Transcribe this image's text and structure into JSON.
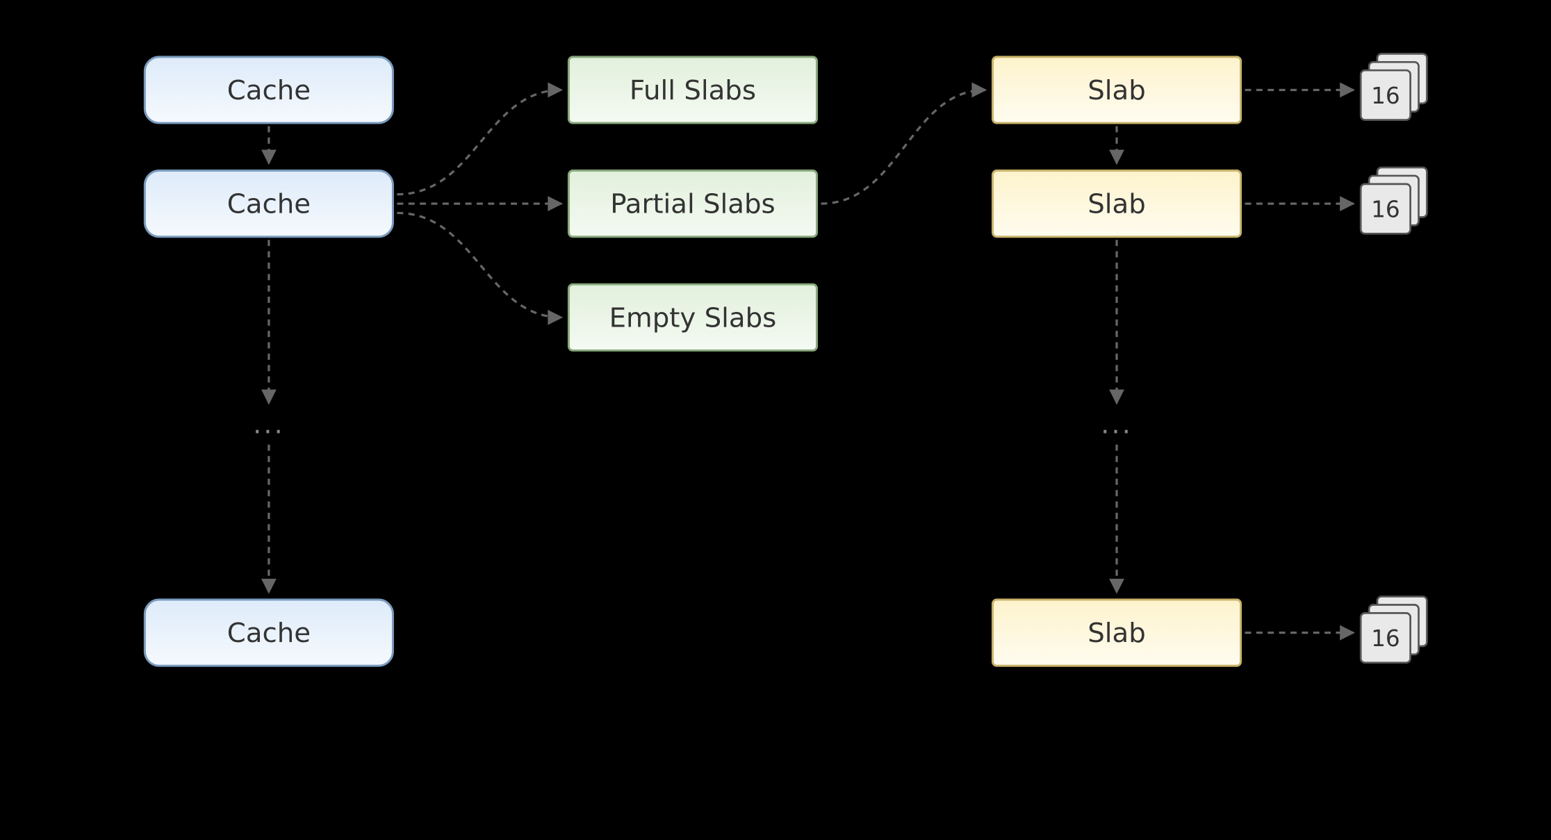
{
  "diagram": {
    "caches": {
      "label": "Cache",
      "ellipsis": "..."
    },
    "slab_groups": {
      "full": "Full Slabs",
      "partial": "Partial Slabs",
      "empty": "Empty Slabs"
    },
    "slab": {
      "label": "Slab",
      "ellipsis": "..."
    },
    "page": {
      "value": "16"
    },
    "colors": {
      "cache_fill_top": "#deebfa",
      "cache_fill_bot": "#f5f9fd",
      "cache_stroke": "#7a9bbd",
      "group_fill_top": "#e2f0dc",
      "group_fill_bot": "#f4faf2",
      "group_stroke": "#88a87c",
      "slab_fill_top": "#fdf3cc",
      "slab_fill_bot": "#fffcf0",
      "slab_stroke": "#c9b36a",
      "page_fill": "#e9e9e9",
      "page_stroke": "#555555",
      "arrow": "#666666"
    }
  }
}
